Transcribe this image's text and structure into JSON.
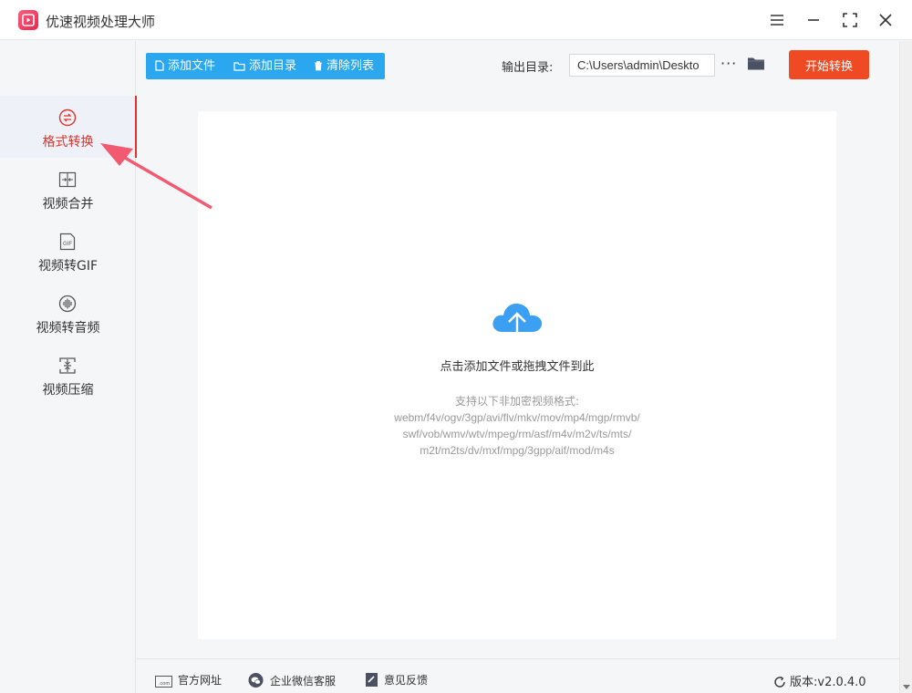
{
  "window": {
    "title": "优速视频处理大师",
    "controls": [
      "menu-icon",
      "minimize-icon",
      "maximize-icon",
      "close-icon"
    ]
  },
  "sidebar": {
    "items": [
      {
        "label": "格式转换",
        "icon": "convert-icon",
        "active": true
      },
      {
        "label": "视频合并",
        "icon": "merge-icon",
        "active": false
      },
      {
        "label": "视频转GIF",
        "icon": "gif-icon",
        "active": false
      },
      {
        "label": "视频转音频",
        "icon": "audio-icon",
        "active": false
      },
      {
        "label": "视频压缩",
        "icon": "compress-icon",
        "active": false
      }
    ]
  },
  "toolbar": {
    "add_file": "添加文件",
    "add_folder": "添加目录",
    "clear_list": "清除列表",
    "output_label": "输出目录:",
    "output_path": "C:\\Users\\admin\\Deskto",
    "more": "···",
    "start": "开始转换"
  },
  "dropzone": {
    "hint": "点击添加文件或拖拽文件到此",
    "formats_title": "支持以下非加密视频格式:",
    "formats_lines": [
      "webm/f4v/ogv/3gp/avi/flv/mkv/mov/mp4/mgp/rmvb/",
      "swf/vob/wmv/wtv/mpeg/rm/asf/m4v/m2v/ts/mts/",
      "m2t/m2ts/dv/mxf/mpg/3gpp/aif/mod/m4s"
    ]
  },
  "footer": {
    "website": "官方网址",
    "wechat": "企业微信客服",
    "feedback": "意见反馈",
    "version": "版本:v2.0.4.0"
  },
  "colors": {
    "accent_red": "#e0332c",
    "start_button": "#f04a25",
    "toolbar_blue": "#2aa7ee",
    "cloud_blue": "#3ba0f2"
  }
}
